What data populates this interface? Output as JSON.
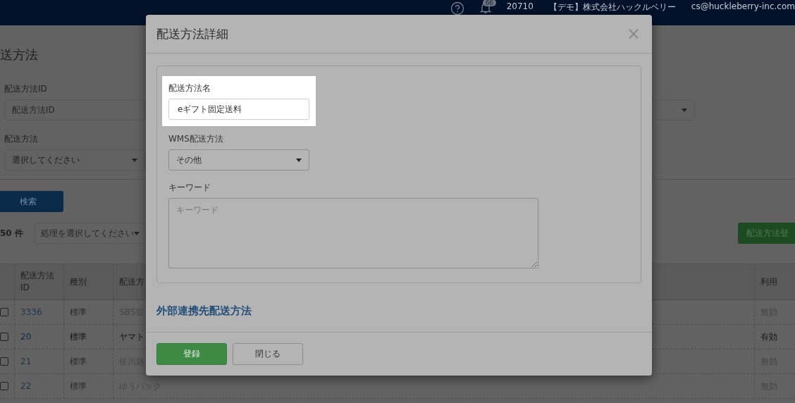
{
  "topbar": {
    "notification_count": "66",
    "user_code": "20710",
    "company": "【デモ】株式会社ハックルベリー",
    "email": "cs@huckleberry-inc.com"
  },
  "page": {
    "title": "送方法",
    "filters": [
      {
        "kind": "text",
        "label": "配送方法ID",
        "placeholder": "配送方法ID"
      },
      {
        "kind": "select",
        "label": "配送方法",
        "value": "選択してください"
      }
    ],
    "search_button": "検索",
    "count": "50 件",
    "bulk_action": "処理を選択してください",
    "register_button": "配送方法登"
  },
  "table": {
    "columns": [
      "配送方法\nID",
      "種別",
      "配送方",
      "利用"
    ],
    "rows": [
      {
        "checked": false,
        "active": false,
        "id": "3336",
        "type": "標準",
        "name": "SBS翌",
        "usage": "無効"
      },
      {
        "checked": false,
        "active": true,
        "id": "20",
        "type": "標準",
        "name": "ヤマト",
        "usage": "有効"
      },
      {
        "checked": false,
        "active": false,
        "id": "21",
        "type": "標準",
        "name": "佐川急",
        "usage": "無効"
      },
      {
        "checked": false,
        "active": false,
        "id": "22",
        "type": "標準",
        "name": "ゆうパック",
        "usage": "無効"
      }
    ]
  },
  "modal": {
    "title": "配送方法詳細",
    "close": "×",
    "fields": [
      {
        "kind": "text",
        "label": "配送方法名",
        "value": "eギフト固定送料",
        "highlighted": true
      },
      {
        "kind": "select",
        "label": "WMS配送方法",
        "value": "その他",
        "highlighted": false
      },
      {
        "kind": "textarea",
        "label": "キーワード",
        "placeholder": "キーワード",
        "highlighted": false
      }
    ],
    "section_link": "外部連携先配送方法",
    "buttons": [
      {
        "kind": "primary",
        "label": "登録"
      },
      {
        "kind": "default",
        "label": "閉じる"
      }
    ]
  }
}
